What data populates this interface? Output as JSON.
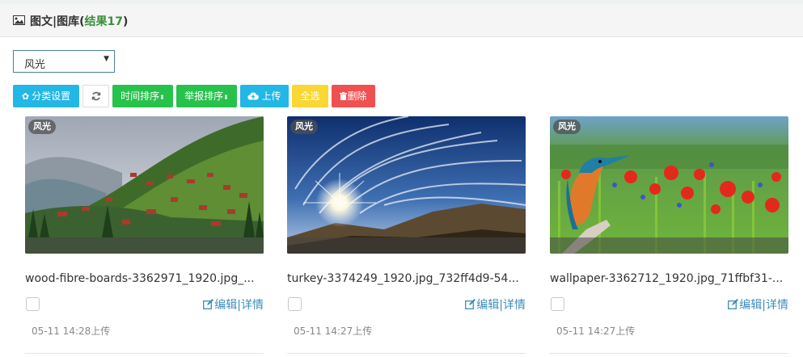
{
  "header": {
    "icon": "image-icon",
    "title": "图文|图库(",
    "result_label": "结果",
    "result_count": "17",
    "title_close": ")"
  },
  "filter": {
    "selected": "风光"
  },
  "toolbar": {
    "category_settings": "分类设置",
    "sort_time": "时间排序",
    "sort_report": "举报排序",
    "upload": "上传",
    "select_all": "全选",
    "delete": "删除"
  },
  "colors": {
    "blue": "#23b7e5",
    "green": "#27c24c",
    "yellow": "#fad733",
    "red": "#f05050",
    "link": "#3c8dbc"
  },
  "cards": [
    {
      "tag": "风光",
      "filename": "wood-fibre-boards-3362971_1920.jpg_...",
      "edit": "编辑",
      "sep": "|",
      "detail": "详情",
      "uploaded": "05-11 14:28上传"
    },
    {
      "tag": "风光",
      "filename": "turkey-3374249_1920.jpg_732ff4d9-54...",
      "edit": "编辑",
      "sep": "|",
      "detail": "详情",
      "uploaded": "05-11 14:27上传"
    },
    {
      "tag": "风光",
      "filename": "wallpaper-3362712_1920.jpg_71ffbf31-...",
      "edit": "编辑",
      "sep": "|",
      "detail": "详情",
      "uploaded": "05-11 14:27上传"
    }
  ]
}
